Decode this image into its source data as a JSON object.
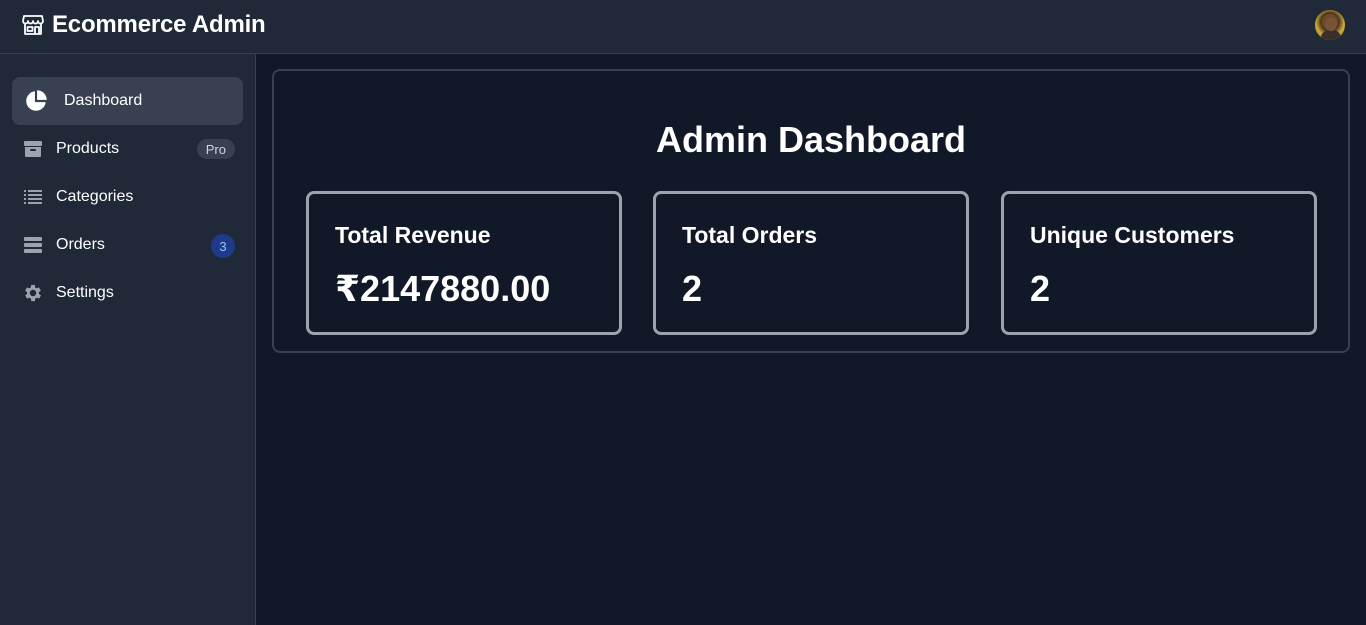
{
  "app": {
    "title": "Ecommerce Admin",
    "brand_icon": "store-icon",
    "avatar_icon": "user-avatar"
  },
  "sidebar": {
    "items": [
      {
        "label": "Dashboard",
        "icon": "pie-chart-icon",
        "active": true
      },
      {
        "label": "Products",
        "icon": "archive-box-icon",
        "badge": "Pro"
      },
      {
        "label": "Categories",
        "icon": "list-icon"
      },
      {
        "label": "Orders",
        "icon": "table-rows-icon",
        "badge": "3"
      },
      {
        "label": "Settings",
        "icon": "gear-icon"
      }
    ]
  },
  "main": {
    "title": "Admin Dashboard",
    "cards": [
      {
        "label": "Total Revenue",
        "value": "₹2147880.00"
      },
      {
        "label": "Total Orders",
        "value": "2"
      },
      {
        "label": "Unique Customers",
        "value": "2"
      }
    ]
  },
  "colors": {
    "background": "#111827",
    "surface": "#1f2937",
    "border": "#374151",
    "card_border": "#9ca3af",
    "badge_blue": "#1e3a8a"
  }
}
